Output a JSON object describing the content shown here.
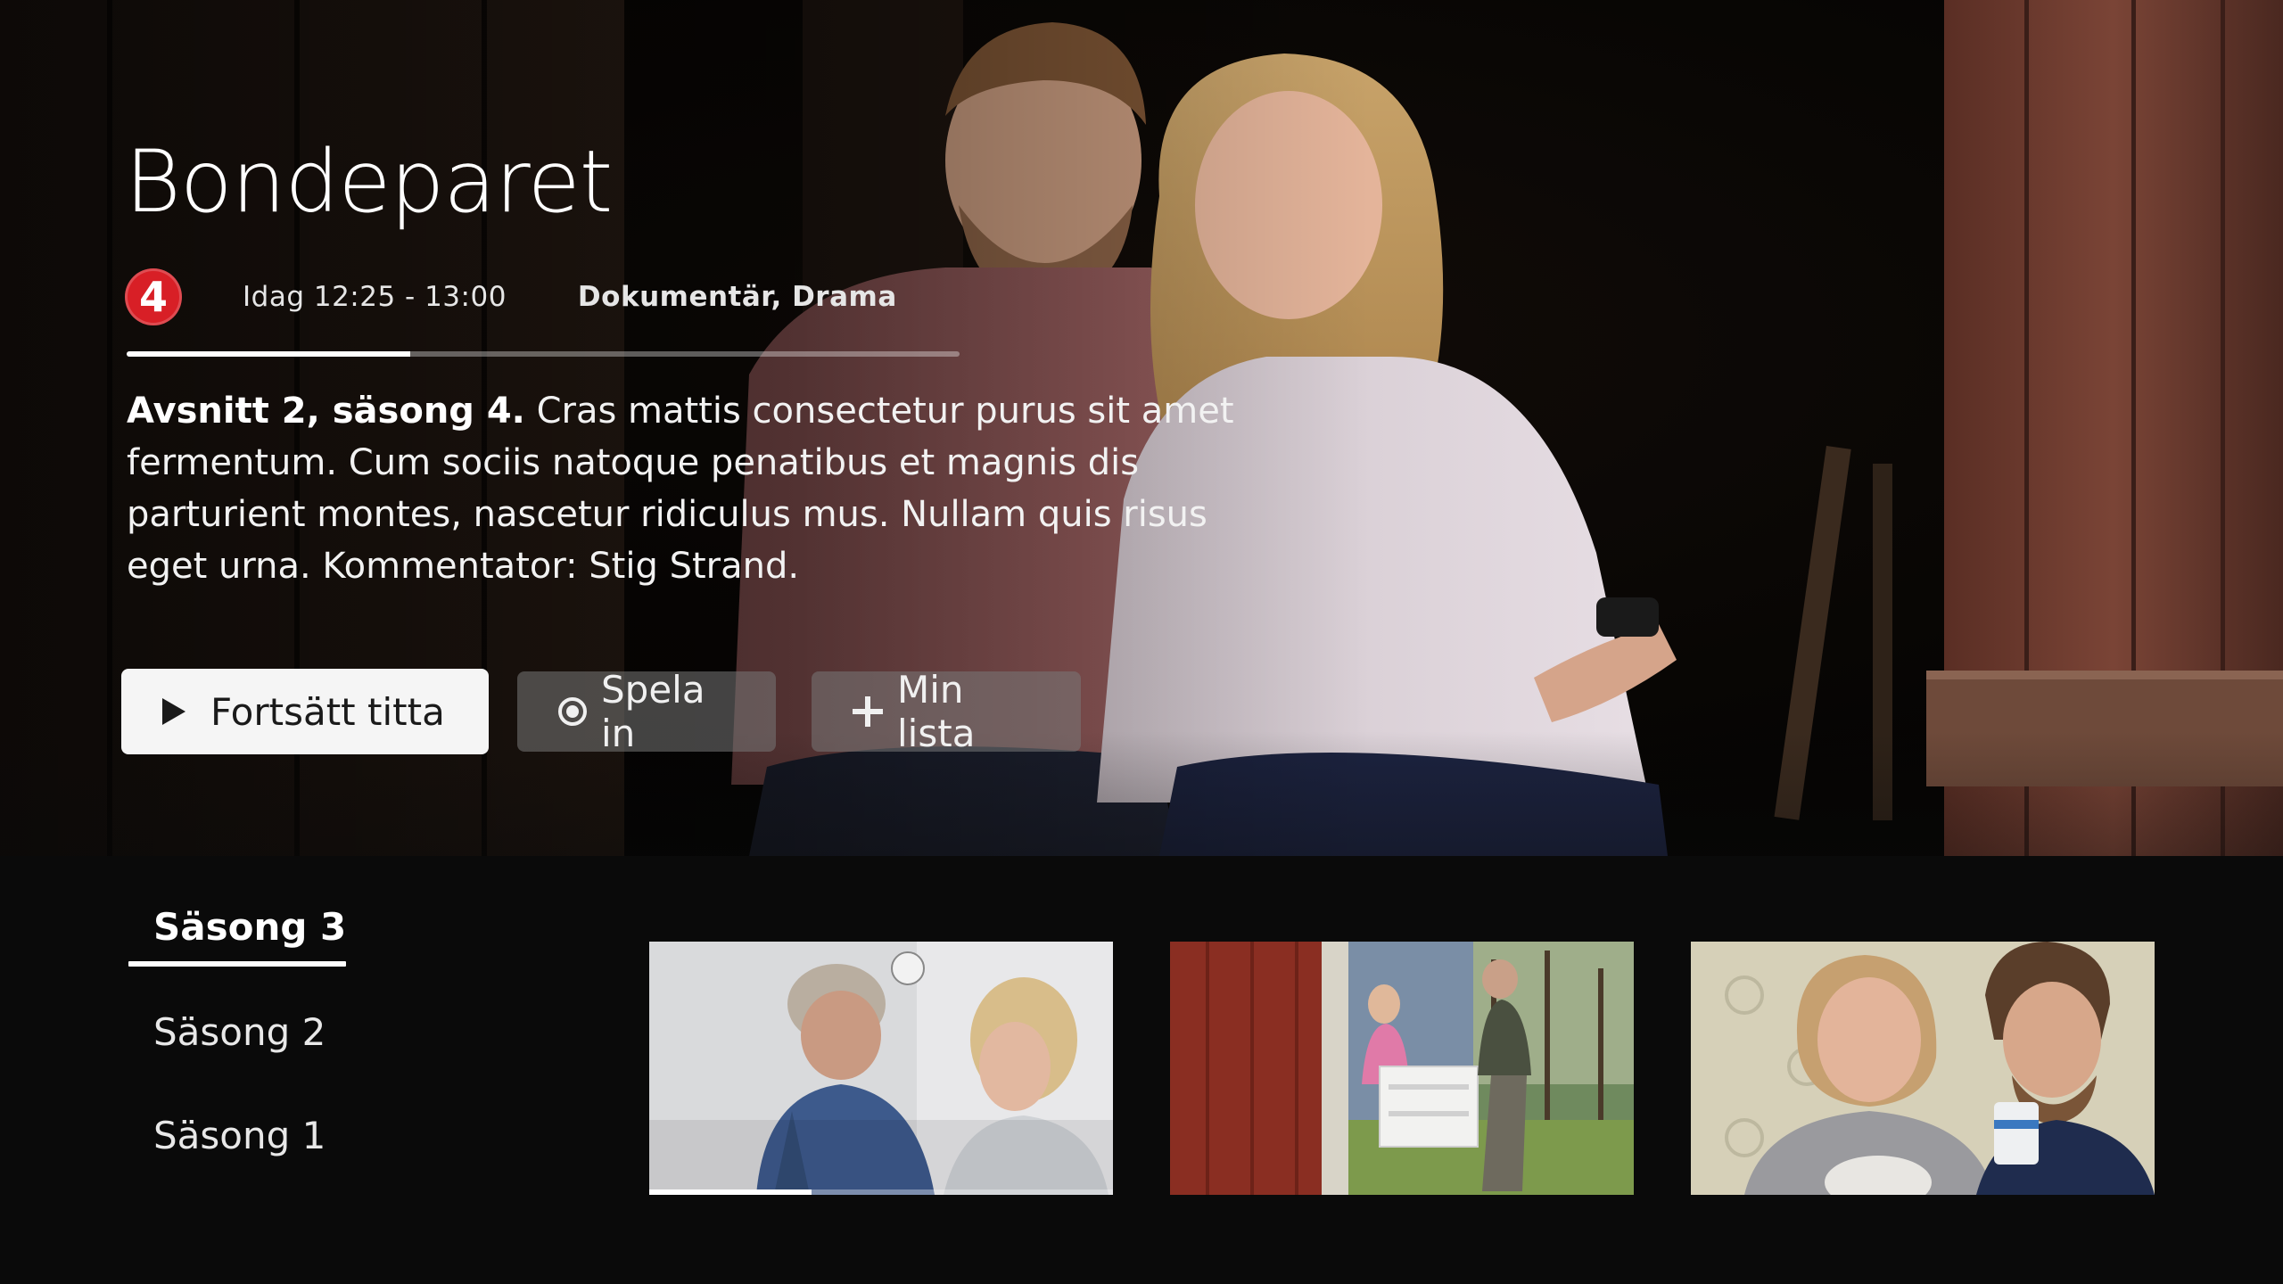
{
  "hero": {
    "title": "Bondeparet",
    "channel_logo_icon": "tv4-logo-icon",
    "channel_number": "4",
    "channel_color": "#d81f26",
    "air_time": "Idag 12:25 - 13:00",
    "genres": "Dokumentär, Drama",
    "progress_fraction": 0.34,
    "episode_label": "Avsnitt 2, säsong 4.",
    "description": "Cras mattis consectetur purus sit amet fermentum. Cum sociis natoque penatibus et magnis dis parturient montes, nascetur ridiculus mus. Nullam quis risus eget urna. Kommentator: Stig Strand."
  },
  "actions": {
    "continue_label": "Fortsätt titta",
    "continue_icon": "play-icon",
    "record_label": "Spela in",
    "record_icon": "record-icon",
    "mylist_label": "Min lista",
    "mylist_icon": "plus-icon"
  },
  "seasons": {
    "items": [
      {
        "label": "Säsong 3",
        "active": true
      },
      {
        "label": "Säsong 2",
        "active": false
      },
      {
        "label": "Säsong 1",
        "active": false
      }
    ]
  },
  "episodes": [
    {
      "name": "episode-thumbnail-1",
      "progress_fraction": 0.35
    },
    {
      "name": "episode-thumbnail-2"
    },
    {
      "name": "episode-thumbnail-3"
    }
  ],
  "colors": {
    "background": "#0a0a0a",
    "primary_button": "#f5f5f5",
    "secondary_button": "#787878"
  }
}
